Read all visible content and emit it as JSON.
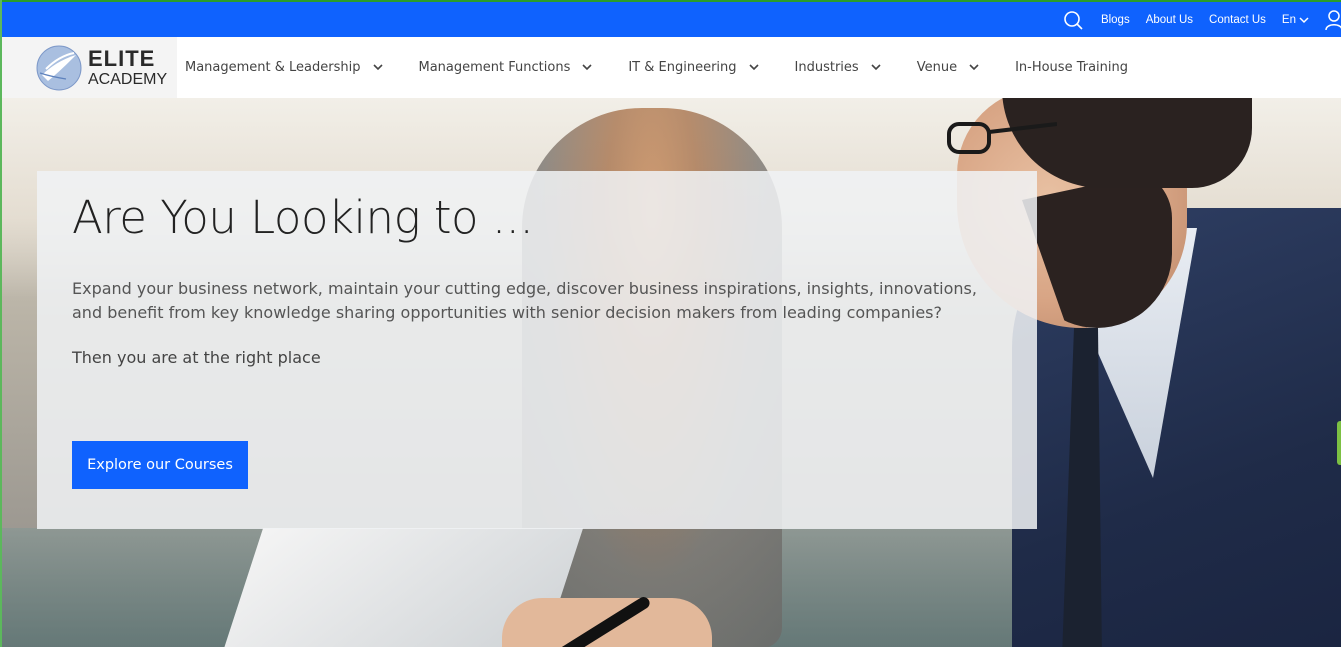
{
  "topbar": {
    "links": [
      "Blogs",
      "About Us",
      "Contact Us"
    ],
    "language": "En",
    "icons": [
      "search-icon",
      "chevron-down-icon",
      "user-icon"
    ]
  },
  "logo": {
    "line1": "ELITE",
    "line2": "ACADEMY"
  },
  "nav": {
    "items": [
      {
        "label": "Management & Leadership",
        "dropdown": true
      },
      {
        "label": "Management Functions",
        "dropdown": true
      },
      {
        "label": "IT & Engineering",
        "dropdown": true
      },
      {
        "label": "Industries",
        "dropdown": true
      },
      {
        "label": "Venue",
        "dropdown": true
      },
      {
        "label": "In-House Training",
        "dropdown": false
      }
    ]
  },
  "hero": {
    "title": "Are You Looking to ...",
    "description": "Expand your business network, maintain your cutting edge, discover business inspirations, insights, innovations, and benefit from key knowledge sharing opportunities with senior decision makers from leading companies?",
    "tagline": "Then you are at the right place",
    "cta_label": "Explore our Courses"
  },
  "colors": {
    "primary": "#0f62fe",
    "card_bg": "#f0f2f4",
    "text_dark": "#222222"
  }
}
